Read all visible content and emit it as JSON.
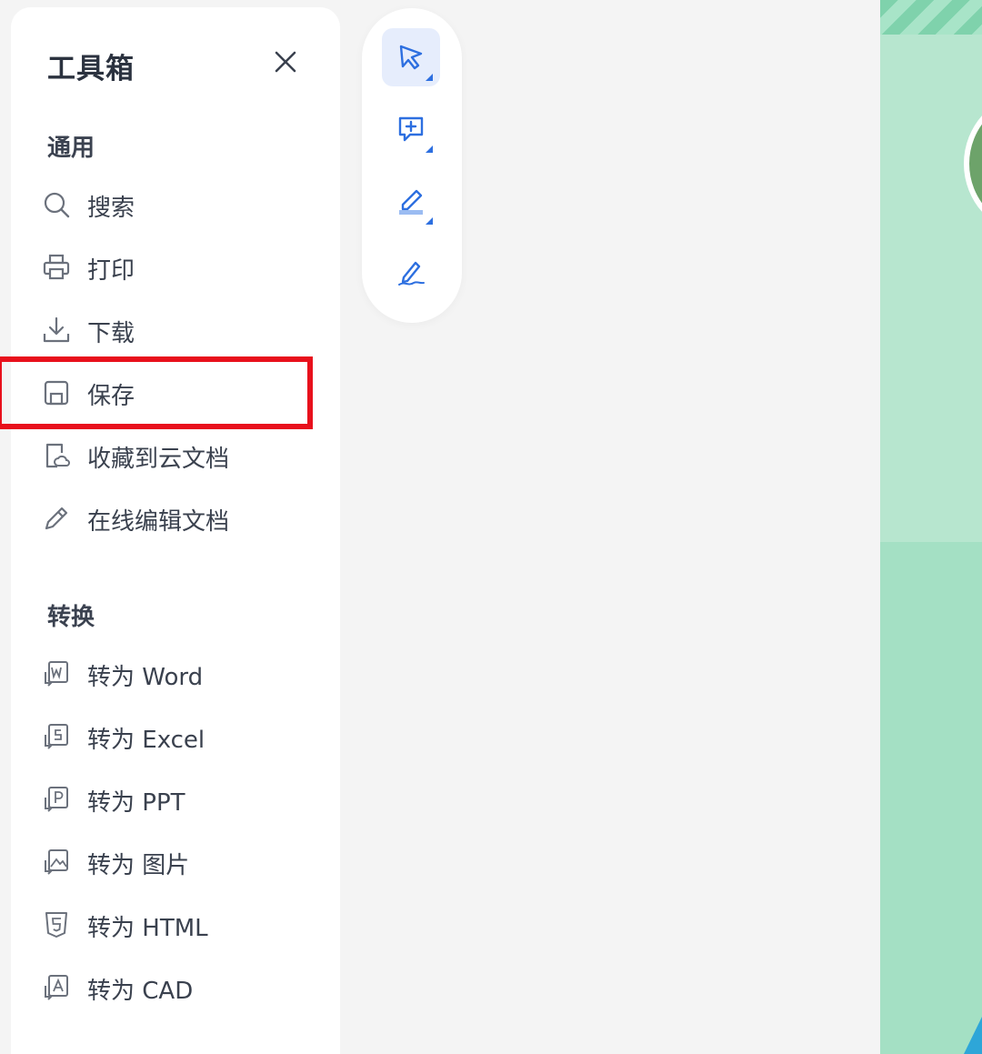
{
  "toolbox": {
    "title": "工具箱",
    "close_icon": "close-icon",
    "sections": [
      {
        "title": "通用",
        "items": [
          {
            "label": "搜索",
            "icon": "search-icon"
          },
          {
            "label": "打印",
            "icon": "printer-icon"
          },
          {
            "label": "下载",
            "icon": "download-icon"
          },
          {
            "label": "保存",
            "icon": "save-icon",
            "highlighted": true
          },
          {
            "label": "收藏到云文档",
            "icon": "cloud-doc-icon"
          },
          {
            "label": "在线编辑文档",
            "icon": "pencil-icon"
          }
        ]
      },
      {
        "title": "转换",
        "items": [
          {
            "label": "转为 Word",
            "icon": "convert-word-icon"
          },
          {
            "label": "转为 Excel",
            "icon": "convert-excel-icon"
          },
          {
            "label": "转为 PPT",
            "icon": "convert-ppt-icon"
          },
          {
            "label": "转为 图片",
            "icon": "convert-image-icon"
          },
          {
            "label": "转为 HTML",
            "icon": "convert-html-icon"
          },
          {
            "label": "转为 CAD",
            "icon": "convert-cad-icon"
          }
        ]
      }
    ]
  },
  "toolbar": {
    "tools": [
      {
        "icon": "select-cursor-icon",
        "active": true
      },
      {
        "icon": "add-comment-icon",
        "active": false
      },
      {
        "icon": "highlighter-icon",
        "active": false
      },
      {
        "icon": "signature-pen-icon",
        "active": false
      }
    ]
  },
  "colors": {
    "accent": "#2d6fe0",
    "highlight_border": "#e8101c",
    "text": "#3a414e",
    "doc_green": "#a4e0c4"
  }
}
